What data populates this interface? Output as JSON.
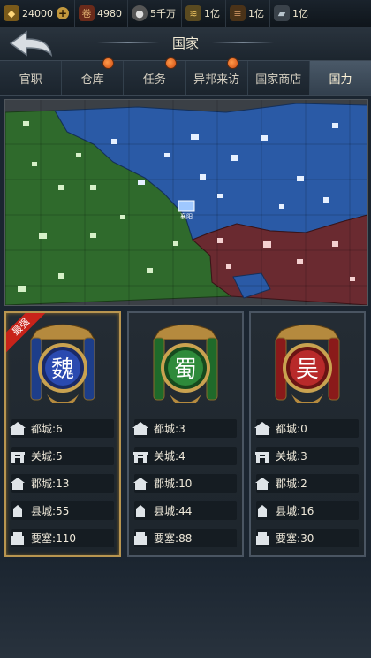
{
  "resources": [
    {
      "name": "ingot",
      "value": "24000",
      "color": "#c79a3a"
    },
    {
      "name": "contribution",
      "value": "4980",
      "color": "#9a4a2a"
    },
    {
      "name": "coin",
      "value": "5千万",
      "color": "#8c8c8c"
    },
    {
      "name": "grain",
      "value": "1亿",
      "color": "#c2a050"
    },
    {
      "name": "wood",
      "value": "1亿",
      "color": "#a07040"
    },
    {
      "name": "iron",
      "value": "1亿",
      "color": "#8a96a0"
    }
  ],
  "title": "国家",
  "tabs": [
    {
      "label": "官职",
      "dot": false
    },
    {
      "label": "仓库",
      "dot": true
    },
    {
      "label": "任务",
      "dot": true
    },
    {
      "label": "异邦来访",
      "dot": true
    },
    {
      "label": "国家商店",
      "dot": false
    },
    {
      "label": "国力",
      "dot": false,
      "active": true
    }
  ],
  "map": {
    "capital_label": "襄阳"
  },
  "kingdoms": [
    {
      "name": "魏",
      "color": "#2a5fc0",
      "badge": "最强",
      "stats": [
        {
          "label": "都城",
          "value": "6"
        },
        {
          "label": "关城",
          "value": "5"
        },
        {
          "label": "郡城",
          "value": "13"
        },
        {
          "label": "县城",
          "value": "55"
        },
        {
          "label": "要塞",
          "value": "110"
        }
      ]
    },
    {
      "name": "蜀",
      "color": "#2e8a3a",
      "badge": "",
      "stats": [
        {
          "label": "都城",
          "value": "3"
        },
        {
          "label": "关城",
          "value": "4"
        },
        {
          "label": "郡城",
          "value": "10"
        },
        {
          "label": "县城",
          "value": "44"
        },
        {
          "label": "要塞",
          "value": "88"
        }
      ]
    },
    {
      "name": "吴",
      "color": "#b82a2a",
      "badge": "",
      "stats": [
        {
          "label": "都城",
          "value": "0"
        },
        {
          "label": "关城",
          "value": "3"
        },
        {
          "label": "郡城",
          "value": "2"
        },
        {
          "label": "县城",
          "value": "16"
        },
        {
          "label": "要塞",
          "value": "30"
        }
      ]
    }
  ]
}
